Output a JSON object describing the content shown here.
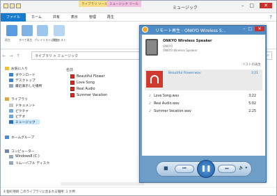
{
  "explorer": {
    "title": "ミュージック",
    "context_tabs": [
      "ライブラリ ツール",
      "ミュージック ツール"
    ],
    "tabs": [
      "ファイル",
      "ホーム",
      "共有",
      "表示",
      "管理",
      "再生"
    ],
    "help": "?",
    "ribbon_buttons": [
      "再生",
      "すべて再生",
      "プレイリストに追加",
      "再生リスト",
      "追加"
    ],
    "address": "ライブラリ > ミュージック",
    "nav": [
      "お気に入り",
      "ダウンロード",
      "デスクトップ",
      "最近表示した場所",
      "ライブラリ",
      "ドキュメント",
      "ピクチャ",
      "ビデオ",
      "ミュージック",
      "ホームグループ",
      "コンピューター",
      "Windows8 (C:)",
      "リムーバブル ディスク"
    ],
    "content_header": "名前",
    "files": [
      "Beautiful Flower",
      "Love Song",
      "Real Audio",
      "Summer Vacation"
    ],
    "status": "4 個の項目   このライブラリに含まれる場所: 1 か所"
  },
  "player": {
    "title": "リモート再生 - ONKYO Wireless S...",
    "device_name": "ONKYO Wireless Speaker",
    "device_sub1": "ONKYO",
    "device_sub2": "ONKYO Wireless Speaker",
    "list_label": "リストの再生",
    "now_playing": {
      "title": "Beautiful Flower.wav",
      "duration": "3:21"
    },
    "tracks": [
      {
        "title": "Love Song.wav",
        "duration": "3:22"
      },
      {
        "title": "Real Audio.wav",
        "duration": "5:02"
      },
      {
        "title": "Summer Vacation.wav",
        "duration": "2:25"
      }
    ],
    "controls": {
      "stop": "■",
      "prev": "⏮",
      "play": "❚❚",
      "next": "⏭",
      "volume": "🔈 ▾"
    }
  },
  "colors": {
    "file_tab": "#1979ca",
    "player_frame": "#6e9ec8",
    "accent_red": "#cf3a2e"
  }
}
